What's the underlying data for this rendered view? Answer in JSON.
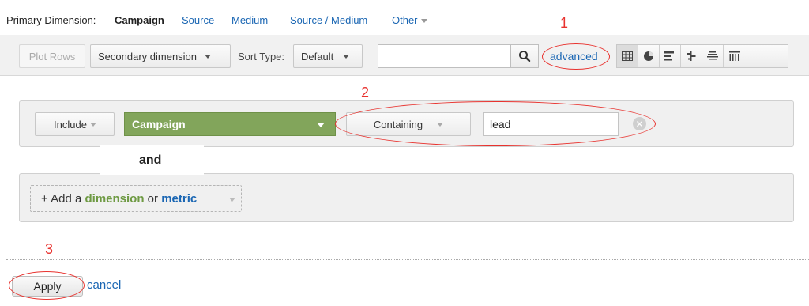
{
  "primary_dimension": {
    "label": "Primary Dimension:",
    "active": "Campaign",
    "options": [
      "Source",
      "Medium",
      "Source / Medium"
    ],
    "other": "Other"
  },
  "toolbar": {
    "plot_rows": "Plot Rows",
    "secondary_dimension": "Secondary dimension",
    "sort_type_label": "Sort Type:",
    "sort_type_value": "Default",
    "search_value": "",
    "advanced_link": "advanced",
    "view_icons": [
      "table-icon",
      "pie-icon",
      "bar-icon",
      "comparison-icon",
      "term-cloud-icon",
      "pivot-icon"
    ]
  },
  "filter": {
    "include": "Include",
    "dimension": "Campaign",
    "match_type": "Containing",
    "value": "lead",
    "conjunction": "and",
    "add_prefix": "+ Add a",
    "add_dimension": "dimension",
    "add_or": "or",
    "add_metric": "metric"
  },
  "actions": {
    "apply": "Apply",
    "cancel": "cancel"
  },
  "annotations": [
    "1",
    "2",
    "3"
  ],
  "colors": {
    "annotation": "#e8322e",
    "dimension_green": "#82a55b",
    "link_blue": "#1a66b3"
  }
}
